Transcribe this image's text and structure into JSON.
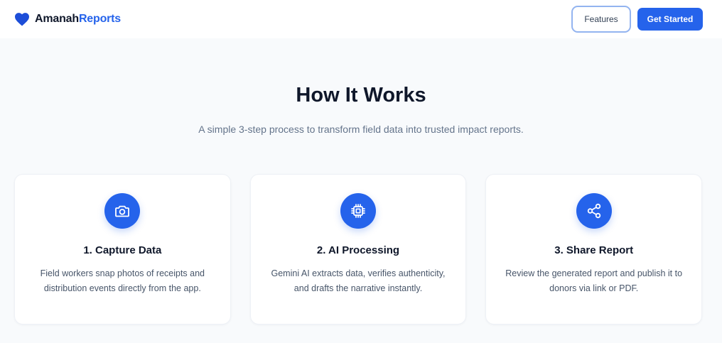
{
  "nav": {
    "brand_part1": "Amanah",
    "brand_part2": "Reports",
    "logo_icon": "heart-icon",
    "features_label": "Features",
    "get_started_label": "Get Started"
  },
  "hero": {
    "title": "How It Works",
    "subtitle": "A simple 3-step process to transform field data into trusted impact reports."
  },
  "steps": [
    {
      "icon": "camera-icon",
      "title": "1. Capture Data",
      "description": "Field workers snap photos of receipts and distribution events directly from the app."
    },
    {
      "icon": "cpu-chip-icon",
      "title": "2. AI Processing",
      "description": "Gemini AI extracts data, verifies authenticity, and drafts the narrative instantly."
    },
    {
      "icon": "share-icon",
      "title": "3. Share Report",
      "description": "Review the generated report and publish it to donors via link or PDF."
    }
  ],
  "colors": {
    "brand": "#2563eb",
    "text_dark": "#0f172a",
    "text_muted": "#64748b",
    "background": "#f8fafc"
  }
}
